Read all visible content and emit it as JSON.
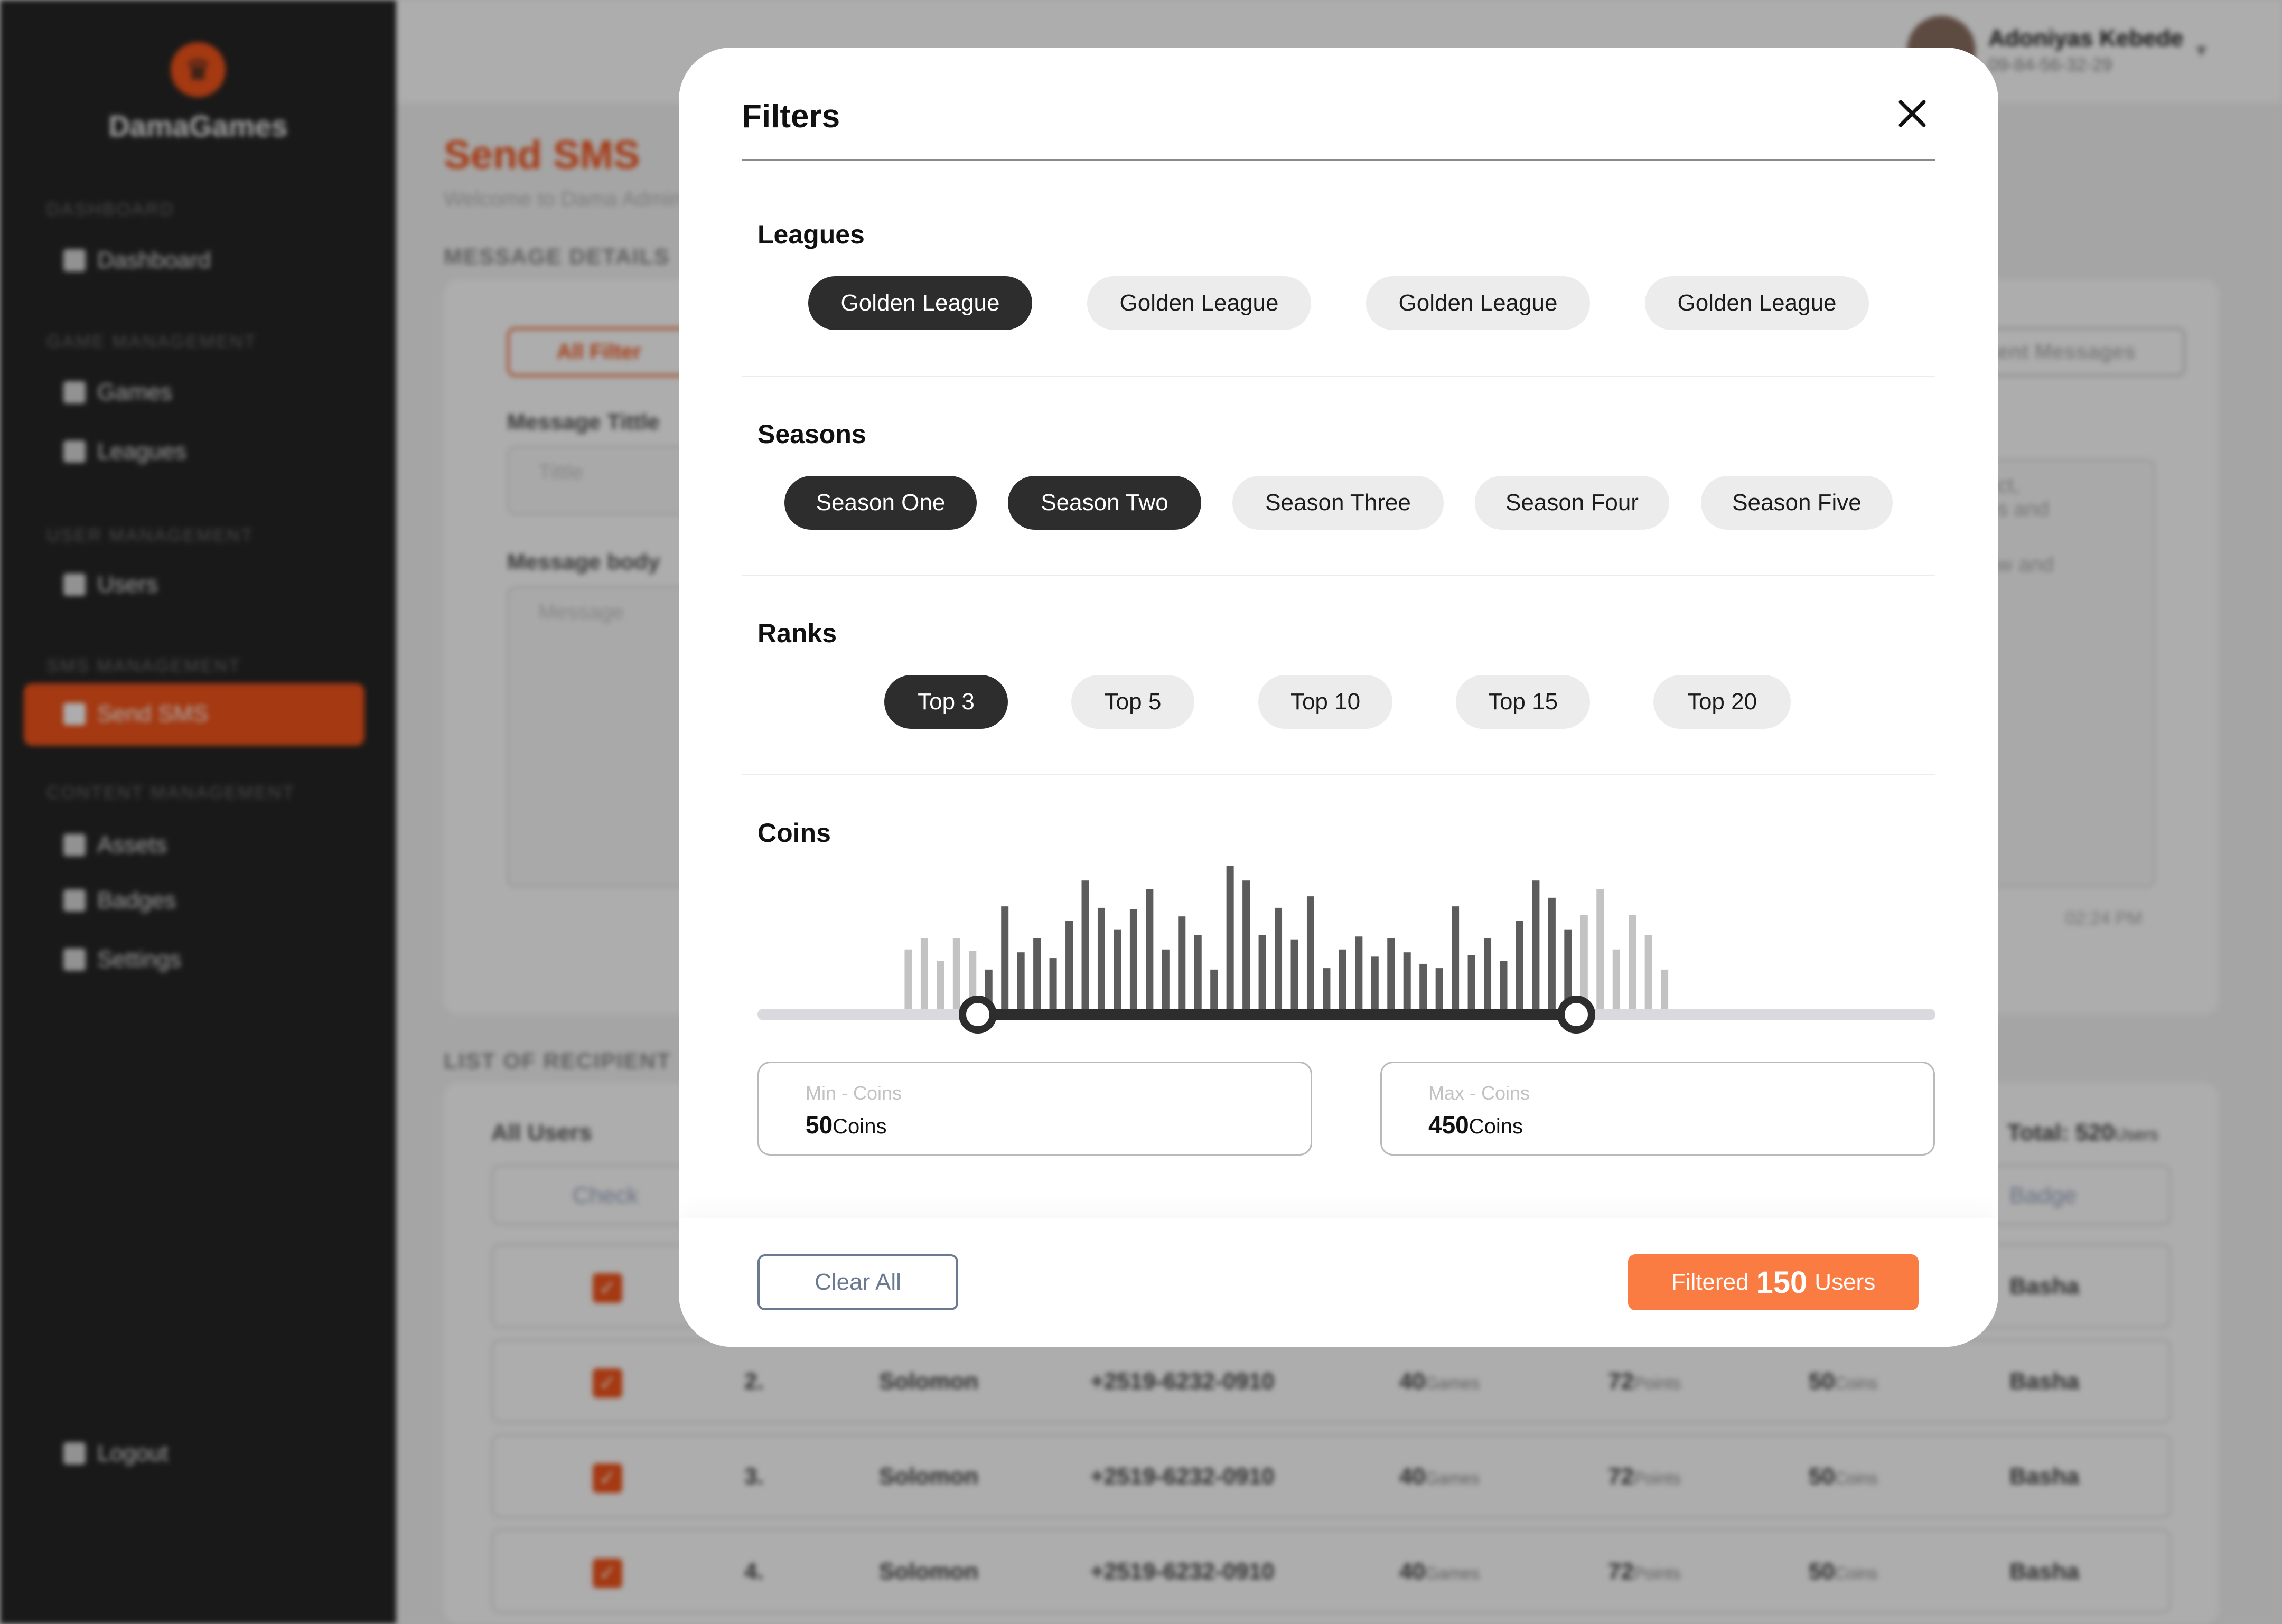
{
  "app": {
    "brand": "DamaGames",
    "user": {
      "name": "Adoniyas Kebede",
      "phone": "09-84-56-32-29"
    },
    "page": {
      "title": "Send SMS",
      "subtitle": "Welcome to Dama Admin"
    },
    "sidebar": {
      "sections": [
        {
          "title": "DASHBOARD",
          "items": [
            {
              "label": "Dashboard",
              "icon": "dashboard-icon"
            }
          ]
        },
        {
          "title": "GAME MANAGEMENT",
          "items": [
            {
              "label": "Games",
              "icon": "checkerboard-icon"
            },
            {
              "label": "Leagues",
              "icon": "trophy-icon"
            }
          ]
        },
        {
          "title": "USER MANAGEMENT",
          "items": [
            {
              "label": "Users",
              "icon": "users-icon"
            }
          ]
        },
        {
          "title": "SMS MANAGEMENT",
          "items": [
            {
              "label": "Send SMS",
              "icon": "message-icon",
              "active": true
            }
          ]
        },
        {
          "title": "CONTENT MANAGEMENT",
          "items": [
            {
              "label": "Assets",
              "icon": "puzzle-icon"
            },
            {
              "label": "Badges",
              "icon": "badge-icon"
            },
            {
              "label": "Settings",
              "icon": "gear-icon"
            }
          ]
        }
      ],
      "logout": "Logout"
    },
    "message": {
      "section_label": "MESSAGE DETAILS",
      "all_filter": "All Filter",
      "sent_messages": "Sent Messages",
      "title_label": "Message Tittle",
      "title_placeholder": "Tittle",
      "body_label": "Message body",
      "body_placeholder": "Message",
      "preview_lines": [
        "uct,",
        "es and",
        "ow and"
      ],
      "time": "02:24 PM"
    },
    "recipients": {
      "section_label": "LIST OF RECIPIENT",
      "all_users": "All Users",
      "total_label": "Total:",
      "total_value": "520",
      "total_unit": "Users",
      "columns": {
        "check": "Check",
        "badge": "Badge"
      },
      "rows": [
        {
          "num": "",
          "name": "",
          "phone": "",
          "games": "",
          "points": "",
          "coins": "",
          "badge": "Basha"
        },
        {
          "num": "2.",
          "name": "Solomon",
          "phone": "+2519-6232-0910",
          "games": "40",
          "points": "72",
          "coins": "50",
          "badge": "Basha"
        },
        {
          "num": "3.",
          "name": "Solomon",
          "phone": "+2519-6232-0910",
          "games": "40",
          "points": "72",
          "coins": "50",
          "badge": "Basha"
        },
        {
          "num": "4.",
          "name": "Solomon",
          "phone": "+2519-6232-0910",
          "games": "40",
          "points": "72",
          "coins": "50",
          "badge": "Basha"
        }
      ],
      "units": {
        "games": "Games",
        "points": "Points",
        "coins": "Coins"
      }
    }
  },
  "modal": {
    "title": "Filters",
    "leagues": {
      "heading": "Leagues",
      "options": [
        "Golden League",
        "Golden League",
        "Golden League",
        "Golden League"
      ],
      "selected": [
        0
      ]
    },
    "seasons": {
      "heading": "Seasons",
      "options": [
        "Season One",
        "Season Two",
        "Season Three",
        "Season Four",
        "Season Five"
      ],
      "selected": [
        0,
        1
      ]
    },
    "ranks": {
      "heading": "Ranks",
      "options": [
        "Top 3",
        "Top 5",
        "Top 10",
        "Top 15",
        "Top 20"
      ],
      "selected": [
        0
      ]
    },
    "coins": {
      "heading": "Coins",
      "min_label": "Min - Coins",
      "min_value": "50",
      "max_label": "Max - Coins",
      "max_value": "450",
      "unit": "Coins",
      "range_fraction": [
        0.187,
        0.695
      ],
      "histogram_fraction_start": 0.128,
      "histogram_fraction_end": 0.77,
      "histogram": [
        0.42,
        0.5,
        0.34,
        0.5,
        0.41,
        0.28,
        0.72,
        0.4,
        0.5,
        0.36,
        0.62,
        0.9,
        0.71,
        0.56,
        0.7,
        0.84,
        0.42,
        0.65,
        0.52,
        0.28,
        1.0,
        0.9,
        0.52,
        0.71,
        0.49,
        0.79,
        0.29,
        0.42,
        0.51,
        0.37,
        0.5,
        0.4,
        0.32,
        0.29,
        0.72,
        0.38,
        0.5,
        0.34,
        0.62,
        0.9,
        0.78,
        0.56,
        0.66,
        0.84,
        0.42,
        0.66,
        0.52,
        0.28
      ]
    },
    "footer": {
      "clear": "Clear All",
      "filtered_prefix": "Filtered",
      "filtered_count": "150",
      "filtered_suffix": "Users"
    }
  },
  "colors": {
    "accent": "#f2541b",
    "apply": "#fb7c42",
    "chip_on": "#2d2d2d",
    "chip_off": "#ececec",
    "bar_in": "#5c5c5c",
    "bar_out": "#c3c3c3"
  }
}
